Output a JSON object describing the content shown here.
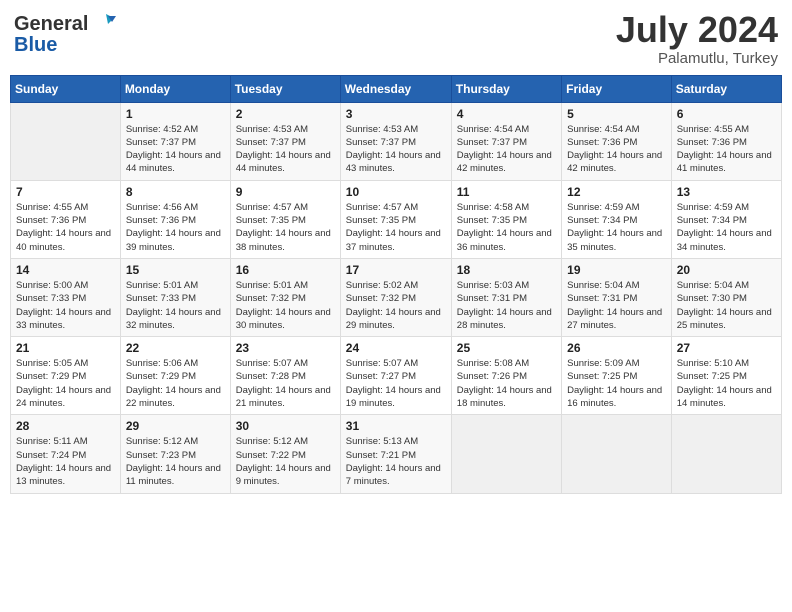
{
  "header": {
    "logo_line1": "General",
    "logo_line2": "Blue",
    "month_year": "July 2024",
    "location": "Palamutlu, Turkey"
  },
  "weekdays": [
    "Sunday",
    "Monday",
    "Tuesday",
    "Wednesday",
    "Thursday",
    "Friday",
    "Saturday"
  ],
  "weeks": [
    [
      {
        "day": "",
        "empty": true
      },
      {
        "day": "1",
        "sunrise": "4:52 AM",
        "sunset": "7:37 PM",
        "daylight": "14 hours and 44 minutes."
      },
      {
        "day": "2",
        "sunrise": "4:53 AM",
        "sunset": "7:37 PM",
        "daylight": "14 hours and 44 minutes."
      },
      {
        "day": "3",
        "sunrise": "4:53 AM",
        "sunset": "7:37 PM",
        "daylight": "14 hours and 43 minutes."
      },
      {
        "day": "4",
        "sunrise": "4:54 AM",
        "sunset": "7:37 PM",
        "daylight": "14 hours and 42 minutes."
      },
      {
        "day": "5",
        "sunrise": "4:54 AM",
        "sunset": "7:36 PM",
        "daylight": "14 hours and 42 minutes."
      },
      {
        "day": "6",
        "sunrise": "4:55 AM",
        "sunset": "7:36 PM",
        "daylight": "14 hours and 41 minutes."
      }
    ],
    [
      {
        "day": "7",
        "sunrise": "4:55 AM",
        "sunset": "7:36 PM",
        "daylight": "14 hours and 40 minutes."
      },
      {
        "day": "8",
        "sunrise": "4:56 AM",
        "sunset": "7:36 PM",
        "daylight": "14 hours and 39 minutes."
      },
      {
        "day": "9",
        "sunrise": "4:57 AM",
        "sunset": "7:35 PM",
        "daylight": "14 hours and 38 minutes."
      },
      {
        "day": "10",
        "sunrise": "4:57 AM",
        "sunset": "7:35 PM",
        "daylight": "14 hours and 37 minutes."
      },
      {
        "day": "11",
        "sunrise": "4:58 AM",
        "sunset": "7:35 PM",
        "daylight": "14 hours and 36 minutes."
      },
      {
        "day": "12",
        "sunrise": "4:59 AM",
        "sunset": "7:34 PM",
        "daylight": "14 hours and 35 minutes."
      },
      {
        "day": "13",
        "sunrise": "4:59 AM",
        "sunset": "7:34 PM",
        "daylight": "14 hours and 34 minutes."
      }
    ],
    [
      {
        "day": "14",
        "sunrise": "5:00 AM",
        "sunset": "7:33 PM",
        "daylight": "14 hours and 33 minutes."
      },
      {
        "day": "15",
        "sunrise": "5:01 AM",
        "sunset": "7:33 PM",
        "daylight": "14 hours and 32 minutes."
      },
      {
        "day": "16",
        "sunrise": "5:01 AM",
        "sunset": "7:32 PM",
        "daylight": "14 hours and 30 minutes."
      },
      {
        "day": "17",
        "sunrise": "5:02 AM",
        "sunset": "7:32 PM",
        "daylight": "14 hours and 29 minutes."
      },
      {
        "day": "18",
        "sunrise": "5:03 AM",
        "sunset": "7:31 PM",
        "daylight": "14 hours and 28 minutes."
      },
      {
        "day": "19",
        "sunrise": "5:04 AM",
        "sunset": "7:31 PM",
        "daylight": "14 hours and 27 minutes."
      },
      {
        "day": "20",
        "sunrise": "5:04 AM",
        "sunset": "7:30 PM",
        "daylight": "14 hours and 25 minutes."
      }
    ],
    [
      {
        "day": "21",
        "sunrise": "5:05 AM",
        "sunset": "7:29 PM",
        "daylight": "14 hours and 24 minutes."
      },
      {
        "day": "22",
        "sunrise": "5:06 AM",
        "sunset": "7:29 PM",
        "daylight": "14 hours and 22 minutes."
      },
      {
        "day": "23",
        "sunrise": "5:07 AM",
        "sunset": "7:28 PM",
        "daylight": "14 hours and 21 minutes."
      },
      {
        "day": "24",
        "sunrise": "5:07 AM",
        "sunset": "7:27 PM",
        "daylight": "14 hours and 19 minutes."
      },
      {
        "day": "25",
        "sunrise": "5:08 AM",
        "sunset": "7:26 PM",
        "daylight": "14 hours and 18 minutes."
      },
      {
        "day": "26",
        "sunrise": "5:09 AM",
        "sunset": "7:25 PM",
        "daylight": "14 hours and 16 minutes."
      },
      {
        "day": "27",
        "sunrise": "5:10 AM",
        "sunset": "7:25 PM",
        "daylight": "14 hours and 14 minutes."
      }
    ],
    [
      {
        "day": "28",
        "sunrise": "5:11 AM",
        "sunset": "7:24 PM",
        "daylight": "14 hours and 13 minutes."
      },
      {
        "day": "29",
        "sunrise": "5:12 AM",
        "sunset": "7:23 PM",
        "daylight": "14 hours and 11 minutes."
      },
      {
        "day": "30",
        "sunrise": "5:12 AM",
        "sunset": "7:22 PM",
        "daylight": "14 hours and 9 minutes."
      },
      {
        "day": "31",
        "sunrise": "5:13 AM",
        "sunset": "7:21 PM",
        "daylight": "14 hours and 7 minutes."
      },
      {
        "day": "",
        "empty": true
      },
      {
        "day": "",
        "empty": true
      },
      {
        "day": "",
        "empty": true
      }
    ]
  ],
  "labels": {
    "sunrise_label": "Sunrise:",
    "sunset_label": "Sunset:",
    "daylight_label": "Daylight:"
  }
}
